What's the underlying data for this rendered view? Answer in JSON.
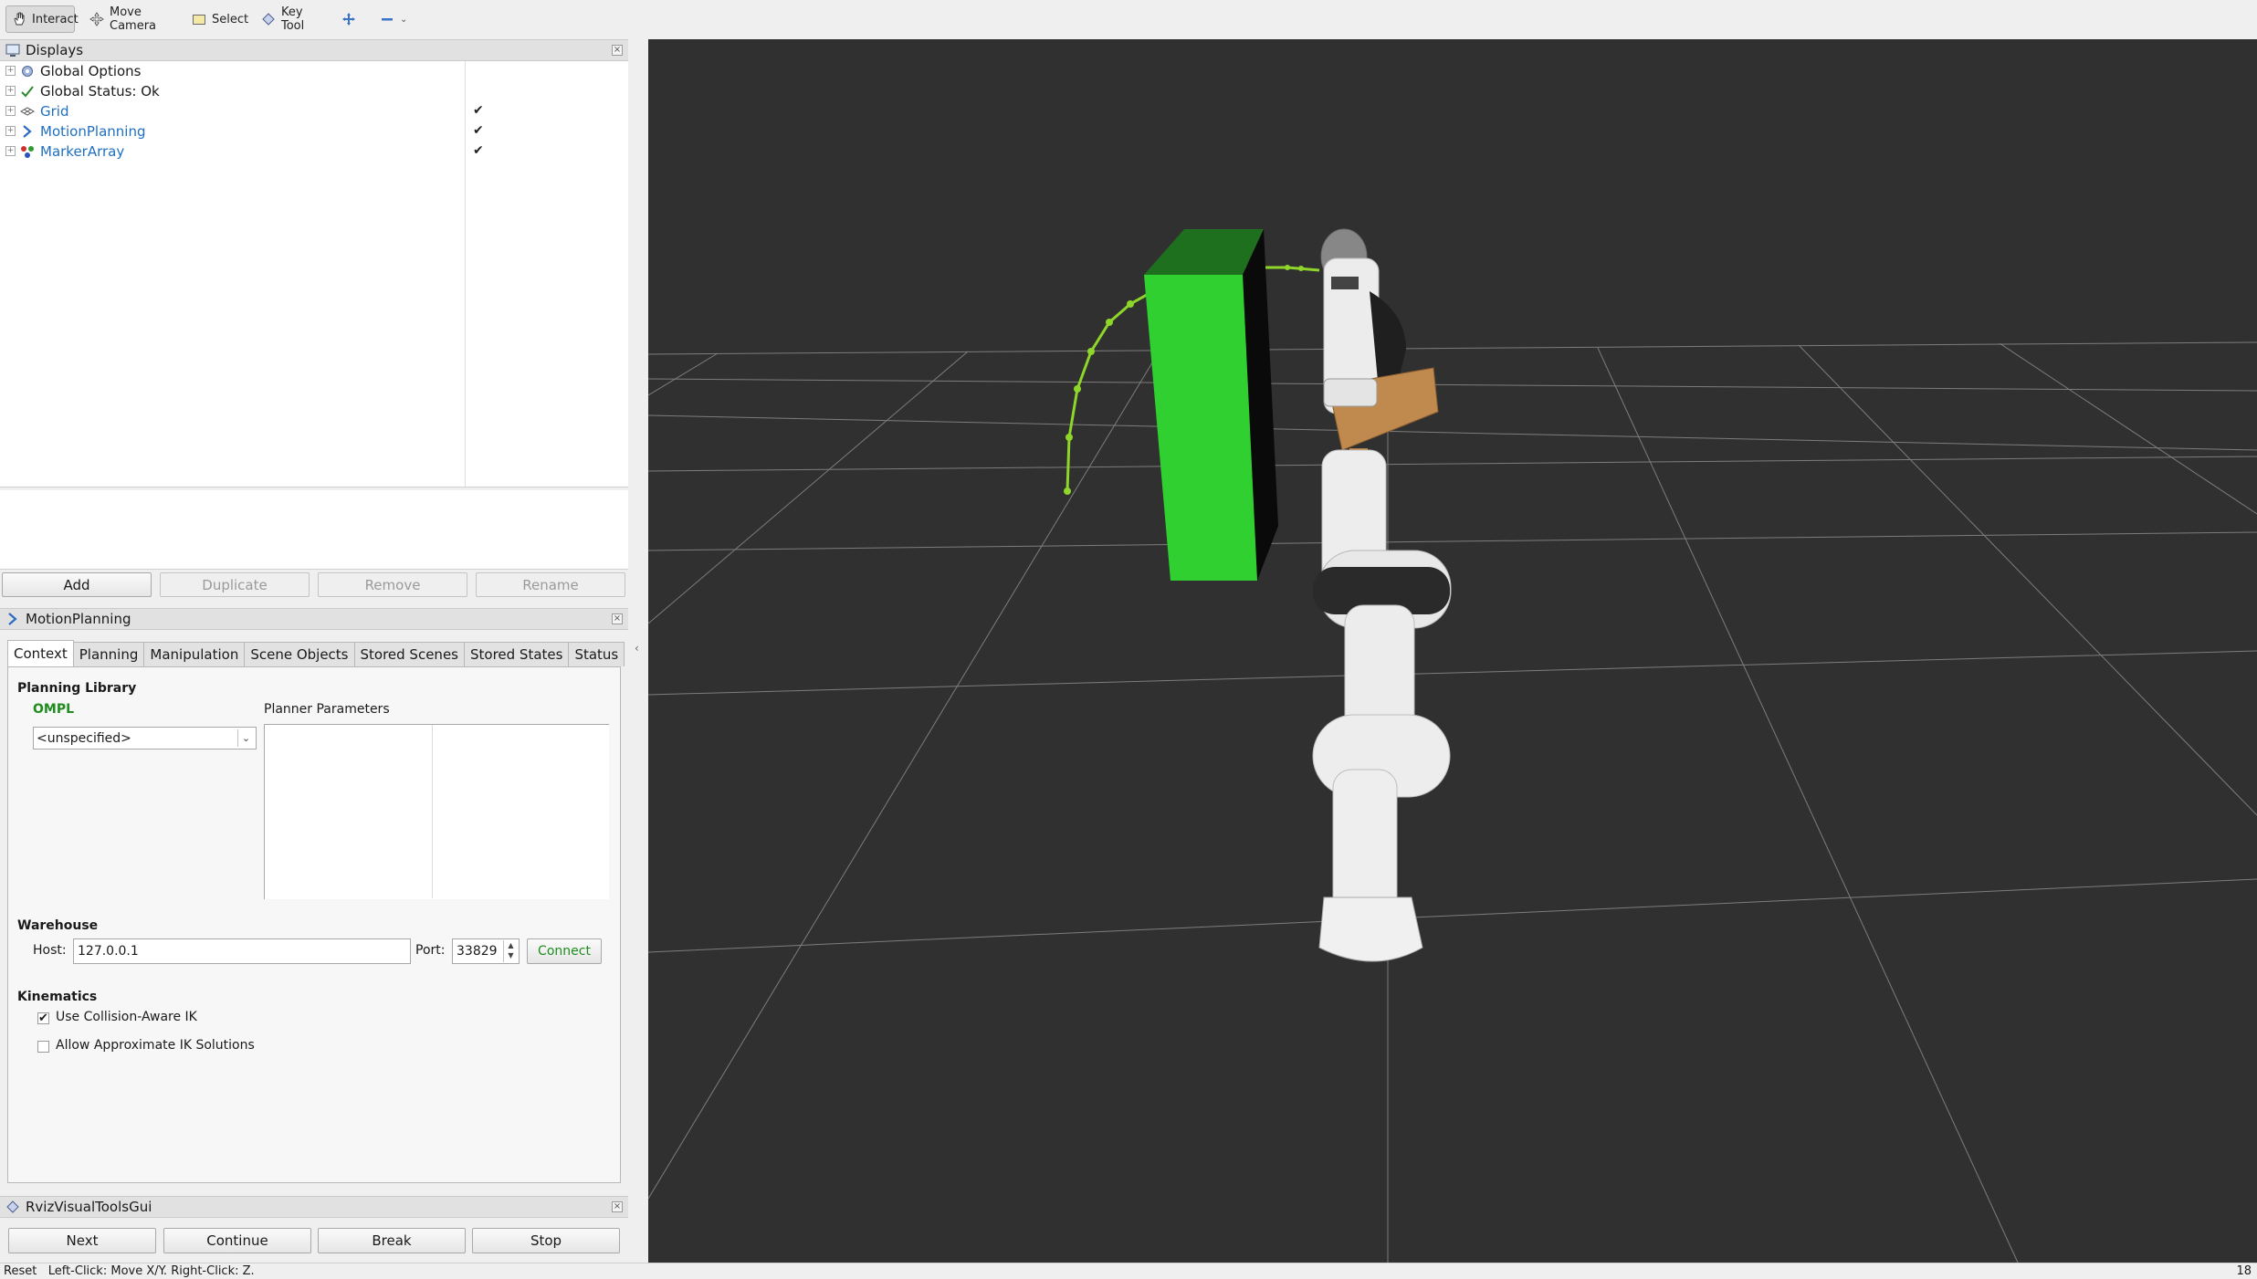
{
  "toolbar": {
    "tools": [
      {
        "label": "Interact",
        "icon": "hand-icon",
        "active": true
      },
      {
        "label": "Move Camera",
        "icon": "move-camera-icon",
        "active": false
      },
      {
        "label": "Select",
        "icon": "select-rect-icon",
        "active": false
      },
      {
        "label": "Key Tool",
        "icon": "diamond-icon",
        "active": false
      }
    ],
    "add_tool_icon": "plus-arrows-icon",
    "remove_tool_icon": "minus-icon"
  },
  "displays": {
    "title": "Displays",
    "items": [
      {
        "label": "Global Options",
        "icon": "gear-icon",
        "checked": null,
        "link": false
      },
      {
        "label": "Global Status: Ok",
        "icon": "checkmark-icon",
        "checked": null,
        "link": false
      },
      {
        "label": "Grid",
        "icon": "grid-icon",
        "checked": true,
        "link": true
      },
      {
        "label": "MotionPlanning",
        "icon": "motion-planning-icon",
        "checked": true,
        "link": true
      },
      {
        "label": "MarkerArray",
        "icon": "marker-array-icon",
        "checked": true,
        "link": true
      }
    ],
    "buttons": {
      "add": "Add",
      "duplicate": "Duplicate",
      "remove": "Remove",
      "rename": "Rename"
    }
  },
  "motion_planning": {
    "title": "MotionPlanning",
    "tabs": [
      "Context",
      "Planning",
      "Manipulation",
      "Scene Objects",
      "Stored Scenes",
      "Stored States",
      "Status"
    ],
    "active_tab": "Context",
    "planning_library": {
      "heading": "Planning Library",
      "library": "OMPL",
      "planner_selected": "<unspecified>",
      "parameters_heading": "Planner Parameters"
    },
    "warehouse": {
      "heading": "Warehouse",
      "host_label": "Host:",
      "host_value": "127.0.0.1",
      "port_label": "Port:",
      "port_value": "33829",
      "connect_label": "Connect"
    },
    "kinematics": {
      "heading": "Kinematics",
      "collision_aware_label": "Use Collision-Aware IK",
      "collision_aware_checked": true,
      "approximate_label": "Allow Approximate IK Solutions",
      "approximate_checked": false
    }
  },
  "rviz_tools": {
    "title": "RvizVisualToolsGui",
    "buttons": {
      "next": "Next",
      "continue": "Continue",
      "break": "Break",
      "stop": "Stop"
    }
  },
  "status_bar": {
    "text": "Reset   Left-Click: Move X/Y. Right-Click: Z.",
    "fps": "18"
  },
  "colors": {
    "viewport_bg": "#303030",
    "grid_line": "#7a7a7a",
    "obstacle_green": "#2fd02f",
    "trajectory_green": "#8fd62a",
    "link_blue": "#1f6fc1",
    "omnl_green": "#1f8c1f"
  }
}
